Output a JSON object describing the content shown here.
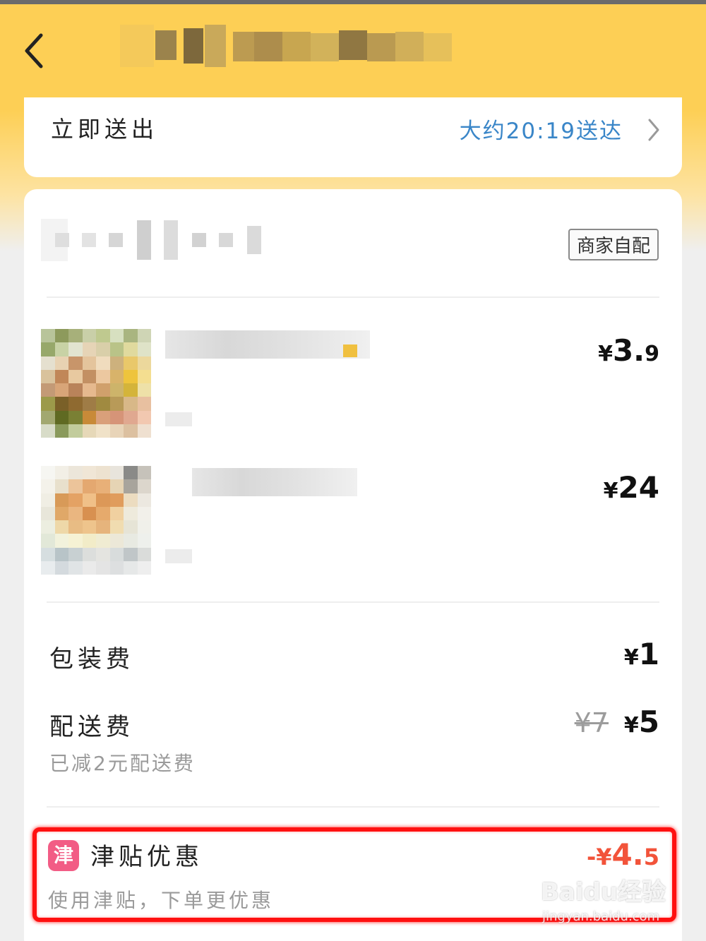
{
  "colors": {
    "header_yellow": "#fdcf55",
    "eta_blue": "#3a86c8",
    "discount_red": "#f2533a",
    "highlight_red": "#ff1010",
    "jin_badge_pink": "#f25c85"
  },
  "header": {
    "back_icon": "chevron-left-icon"
  },
  "delivery_time": {
    "send_now_label": "立即送出",
    "eta_text": "大约20:19送达",
    "chevron_icon": "chevron-right-icon"
  },
  "store": {
    "delivery_tag": "商家自配"
  },
  "items": [
    {
      "price_yen": "¥",
      "price_main": "3.",
      "price_decimal": "9"
    },
    {
      "price_yen": "¥",
      "price_main": "24",
      "price_decimal": ""
    }
  ],
  "fees": {
    "packaging_label": "包装费",
    "packaging_yen": "¥",
    "packaging_amount": "1",
    "delivery_label": "配送费",
    "delivery_old_price": "¥7",
    "delivery_yen": "¥",
    "delivery_amount": "5",
    "delivery_note": "已减2元配送费"
  },
  "subsidy": {
    "badge": "津",
    "label": "津贴优惠",
    "sub_text": "使用津贴，下单更优惠",
    "amount_prefix": "-¥",
    "amount_main": "4.",
    "amount_decimal": "5"
  },
  "watermark": {
    "logo": "Baidu经验",
    "url": "jingyan.baidu.com"
  }
}
